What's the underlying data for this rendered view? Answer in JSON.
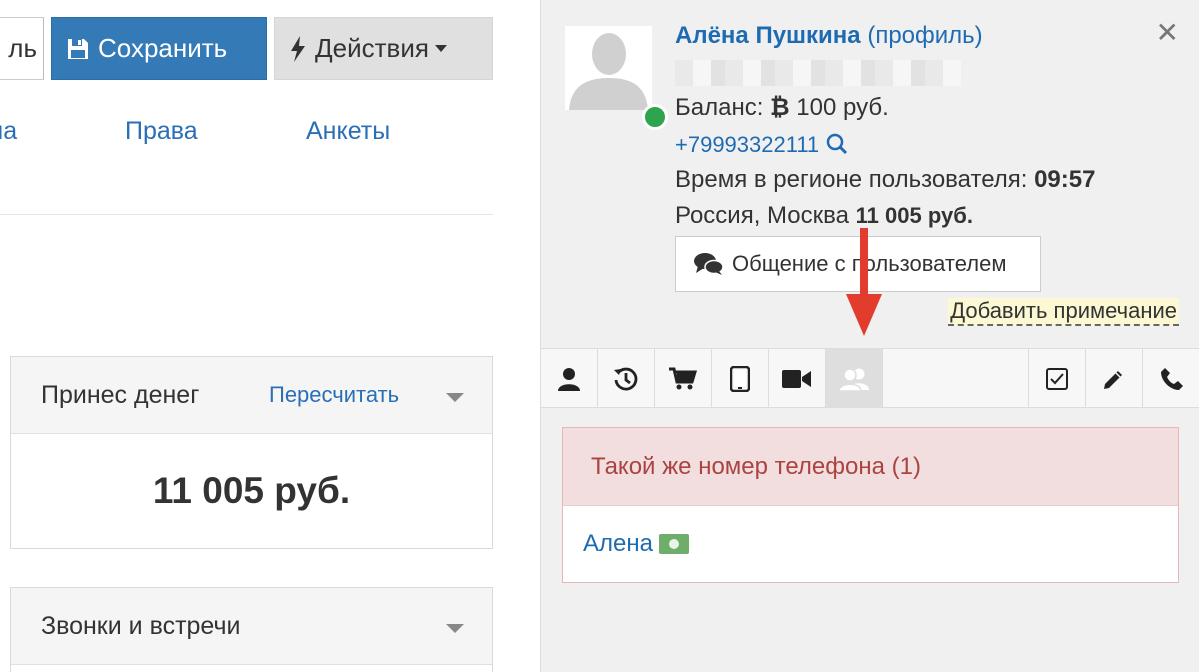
{
  "toolbar": {
    "cut_button_label": "ль",
    "save_label": "Сохранить",
    "actions_label": "Действия"
  },
  "tabs": [
    {
      "label": "ма"
    },
    {
      "label": "Права"
    },
    {
      "label": "Анкеты"
    }
  ],
  "panels": {
    "money": {
      "title": "Принес денег",
      "link": "Пересчитать",
      "value": "11 005 руб."
    },
    "calls": {
      "title": "Звонки и встречи"
    }
  },
  "user": {
    "name": "Алёна Пушкина",
    "profile_link": "(профиль)",
    "balance_label": "Баланс:",
    "balance_value": "100 руб.",
    "phone": "+79993322111",
    "time_label": "Время в регионе пользователя:",
    "time_value": "09:57",
    "location": "Россия, Москва",
    "location_sum": "11 005 руб.",
    "status": "online",
    "status_color": "#2ea44f"
  },
  "chat_button_label": "Общение с пользователем",
  "add_note_label": "Добавить примечание",
  "side_tabs": {
    "left": [
      "user-icon",
      "history-icon",
      "cart-icon",
      "tablet-icon",
      "video-icon",
      "users-icon"
    ],
    "right": [
      "checkbox-icon",
      "pencil-icon",
      "phone-icon"
    ],
    "active": "users-icon"
  },
  "duplicates": {
    "title": "Такой же номер телефона (1)",
    "items": [
      {
        "name": "Алена"
      }
    ]
  },
  "colors": {
    "accent": "#337ab7",
    "link": "#1f6bb3",
    "danger_bg": "#f2dede",
    "danger_text": "#a94442",
    "annotation_arrow": "#e23c2e"
  }
}
